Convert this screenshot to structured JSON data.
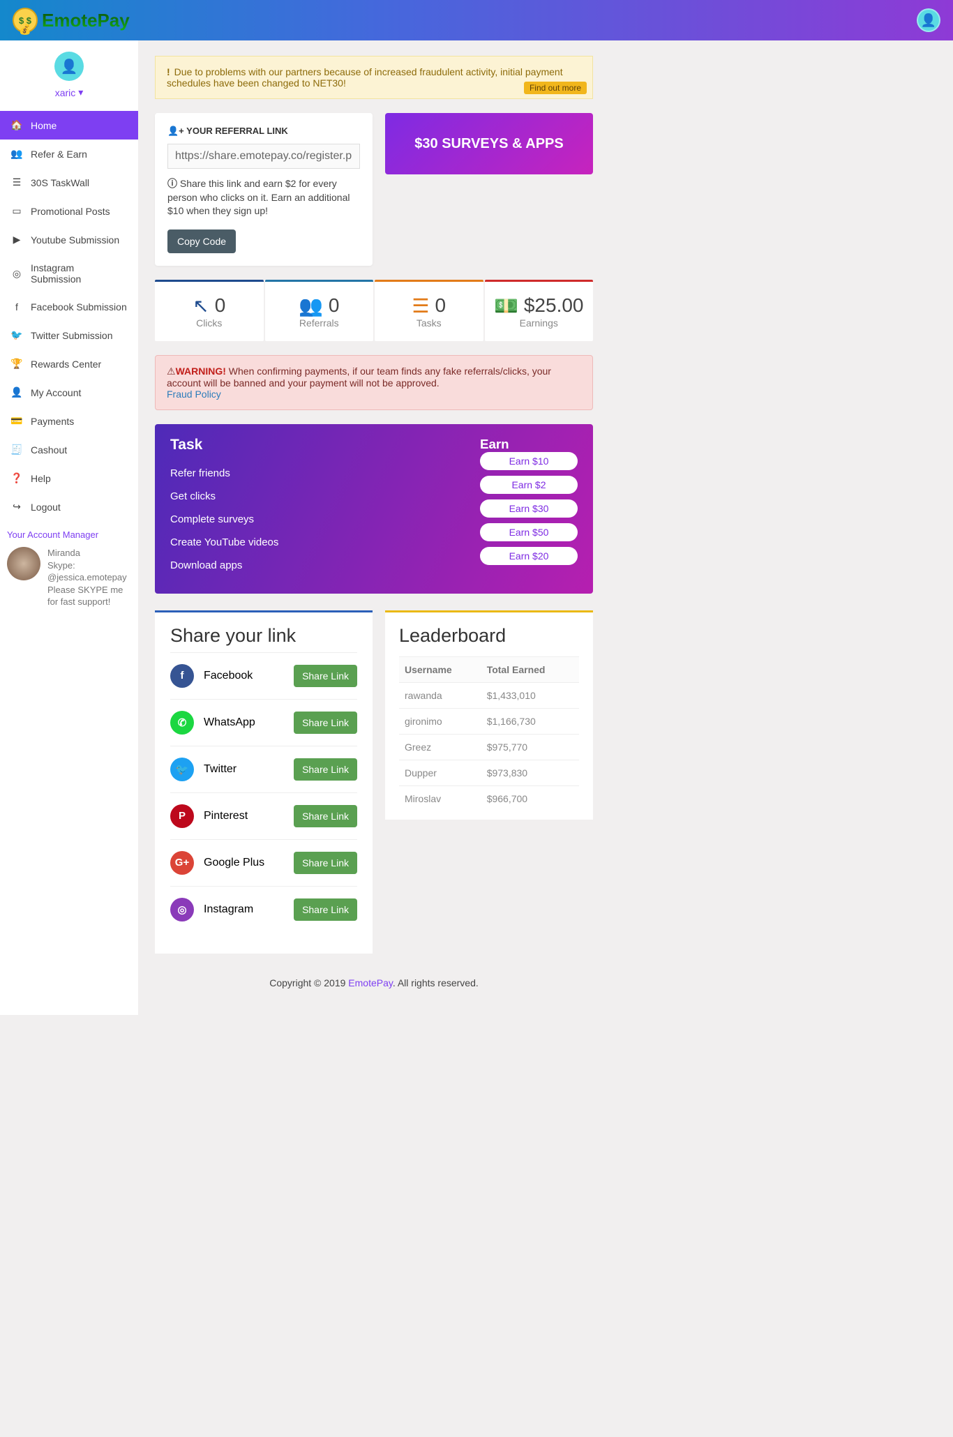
{
  "brand": "EmotePay",
  "user": "xaric",
  "sidebar": {
    "items": [
      {
        "label": "Home",
        "icon": "🏠"
      },
      {
        "label": "Refer & Earn",
        "icon": "👥"
      },
      {
        "label": "30S TaskWall",
        "icon": "☰"
      },
      {
        "label": "Promotional Posts",
        "icon": "▭"
      },
      {
        "label": "Youtube Submission",
        "icon": "▶"
      },
      {
        "label": "Instagram Submission",
        "icon": "◎"
      },
      {
        "label": "Facebook Submission",
        "icon": "f"
      },
      {
        "label": "Twitter Submission",
        "icon": "🐦"
      },
      {
        "label": "Rewards Center",
        "icon": "🏆"
      },
      {
        "label": "My Account",
        "icon": "👤"
      },
      {
        "label": "Payments",
        "icon": "💳"
      },
      {
        "label": "Cashout",
        "icon": "🧾"
      },
      {
        "label": "Help",
        "icon": "❓"
      },
      {
        "label": "Logout",
        "icon": "↪"
      }
    ]
  },
  "acct_mgr": {
    "title": "Your Account Manager",
    "name": "Miranda",
    "line1": "Skype:",
    "line2": "@jessica.emotepay",
    "line3": "Please SKYPE me for fast support!"
  },
  "alert": {
    "text": "Due to problems with our partners because of increased fraudulent activity, initial payment schedules have been changed to NET30!",
    "button": "Find out more"
  },
  "referral": {
    "title": "YOUR REFERRAL LINK",
    "url": "https://share.emotepay.co/register.php",
    "info": "Share this link and earn $2 for every person who clicks on it. Earn an additional $10 when they sign up!",
    "copy": "Copy Code"
  },
  "promo": "$30 SURVEYS & APPS",
  "stats": [
    {
      "val": "0",
      "lbl": "Clicks",
      "icon": "↖",
      "color": "#1e4b8e"
    },
    {
      "val": "0",
      "lbl": "Referrals",
      "icon": "👥",
      "color": "#2375a6"
    },
    {
      "val": "0",
      "lbl": "Tasks",
      "icon": "☰",
      "color": "#e27b19"
    },
    {
      "val": "$25.00",
      "lbl": "Earnings",
      "icon": "💵",
      "color": "#cf2b2b"
    }
  ],
  "warning": {
    "label": "WARNING!",
    "text": " When confirming payments, if our team finds any fake referrals/clicks, your account will be banned and your payment will not be approved.",
    "link": "Fraud Policy"
  },
  "tasks": {
    "task_h": "Task",
    "earn_h": "Earn",
    "rows": [
      {
        "t": "Refer friends",
        "e": "Earn $10"
      },
      {
        "t": "Get clicks",
        "e": "Earn $2"
      },
      {
        "t": "Complete surveys",
        "e": "Earn $30"
      },
      {
        "t": "Create YouTube videos",
        "e": "Earn $50"
      },
      {
        "t": "Download apps",
        "e": "Earn $20"
      }
    ]
  },
  "share": {
    "title": "Share your link",
    "btn": "Share Link",
    "items": [
      {
        "name": "Facebook",
        "bg": "#365493",
        "txt": "f"
      },
      {
        "name": "WhatsApp",
        "bg": "#1bd741",
        "txt": "✆"
      },
      {
        "name": "Twitter",
        "bg": "#1da1f2",
        "txt": "🐦"
      },
      {
        "name": "Pinterest",
        "bg": "#bd081c",
        "txt": "P"
      },
      {
        "name": "Google Plus",
        "bg": "#db4437",
        "txt": "G+"
      },
      {
        "name": "Instagram",
        "bg": "#8a3ab9",
        "txt": "◎"
      }
    ]
  },
  "leaderboard": {
    "title": "Leaderboard",
    "cols": {
      "u": "Username",
      "t": "Total Earned"
    },
    "rows": [
      {
        "u": "rawanda",
        "t": "$1,433,010"
      },
      {
        "u": "gironimo",
        "t": "$1,166,730"
      },
      {
        "u": "Greez",
        "t": "$975,770"
      },
      {
        "u": "Dupper",
        "t": "$973,830"
      },
      {
        "u": "Miroslav",
        "t": "$966,700"
      }
    ]
  },
  "footer": {
    "pre": "Copyright © 2019 ",
    "brand": "EmotePay",
    "post": ". All rights reserved."
  }
}
